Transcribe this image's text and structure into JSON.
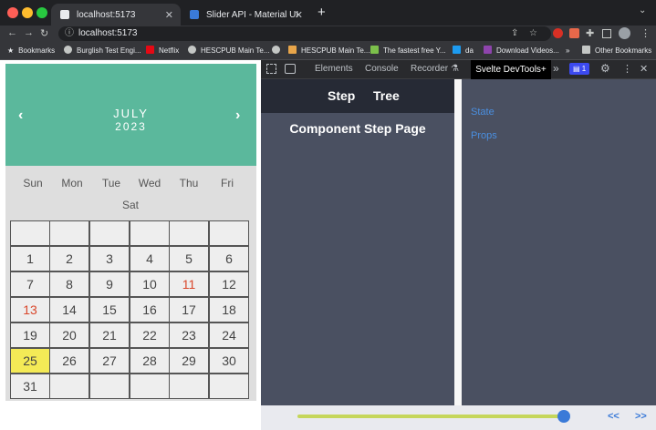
{
  "browser": {
    "tabs": [
      {
        "title": "localhost:5173",
        "active": true
      },
      {
        "title": "Slider API - Material UI",
        "active": false
      }
    ],
    "new_tab": "+",
    "url": "localhost:5173",
    "bookmarks": [
      "Bookmarks",
      "Burglish Test Engi...",
      "Netflix",
      "HESCPUB Main Te...",
      "HESCPUB Main Te...",
      "The fastest free Y...",
      "da",
      "Download Videos...",
      "»",
      "Other Bookmarks"
    ]
  },
  "calendar": {
    "month": "JULY",
    "year": "2023",
    "prev": "‹",
    "next": "›",
    "weekdays": [
      "Sun",
      "Mon",
      "Tue",
      "Wed",
      "Thu",
      "Fri",
      "Sat"
    ],
    "days": [
      "",
      "",
      "",
      "",
      "",
      "",
      "1",
      "2",
      "3",
      "4",
      "5",
      "6",
      "7",
      "8",
      "9",
      "10",
      "11",
      "12",
      "13",
      "14",
      "15",
      "16",
      "17",
      "18",
      "19",
      "20",
      "21",
      "22",
      "23",
      "24",
      "25",
      "26",
      "27",
      "28",
      "29",
      "30",
      "31",
      "",
      "",
      "",
      "",
      ""
    ],
    "red_days": [
      "11",
      "13"
    ],
    "today": "25",
    "colors": {
      "header": "#5bb89c",
      "today": "#f4ea56",
      "red": "#d9472b"
    }
  },
  "devtools": {
    "tabs": [
      "Elements",
      "Console",
      "Recorder"
    ],
    "active_tab": "Svelte DevTools+",
    "more": "»",
    "issues": "1",
    "step_label": "Step",
    "tree_label": "Tree",
    "component_title": "Component Step Page",
    "state_label": "State",
    "props_label": "Props",
    "slider_value": 0.99,
    "prev_label": "<<",
    "next_label": ">>"
  }
}
